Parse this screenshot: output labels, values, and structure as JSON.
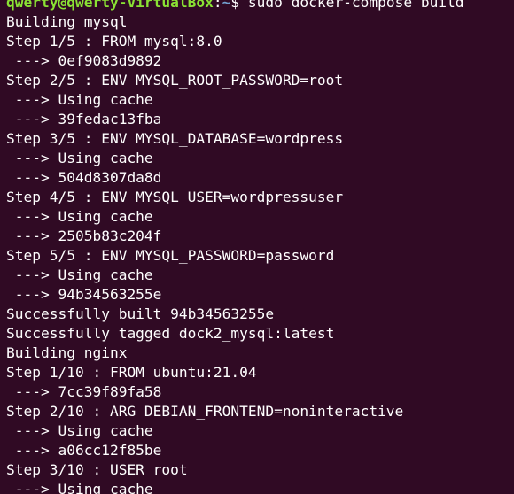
{
  "prompt": {
    "user_host": "qwerty@qwerty-VirtualBox",
    "separator": ":",
    "path": "~",
    "symbol": "$",
    "command": "sudo docker-compose build"
  },
  "colors": {
    "background": "#300a24",
    "text": "#ffffff",
    "prompt_user": "#8ae234",
    "prompt_path": "#729fcf"
  },
  "output": [
    "Building mysql",
    "Step 1/5 : FROM mysql:8.0",
    " ---> 0ef9083d9892",
    "Step 2/5 : ENV MYSQL_ROOT_PASSWORD=root",
    " ---> Using cache",
    " ---> 39fedac13fba",
    "Step 3/5 : ENV MYSQL_DATABASE=wordpress",
    " ---> Using cache",
    " ---> 504d8307da8d",
    "Step 4/5 : ENV MYSQL_USER=wordpressuser",
    " ---> Using cache",
    " ---> 2505b83c204f",
    "Step 5/5 : ENV MYSQL_PASSWORD=password",
    " ---> Using cache",
    " ---> 94b34563255e",
    "Successfully built 94b34563255e",
    "Successfully tagged dock2_mysql:latest",
    "Building nginx",
    "Step 1/10 : FROM ubuntu:21.04",
    " ---> 7cc39f89fa58",
    "Step 2/10 : ARG DEBIAN_FRONTEND=noninteractive",
    " ---> Using cache",
    " ---> a06cc12f85be",
    "Step 3/10 : USER root",
    " ---> Using cache"
  ]
}
